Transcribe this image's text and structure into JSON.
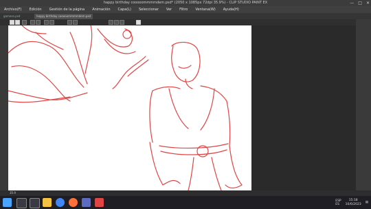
{
  "titlebar": {
    "title": "happy birthday cooooommmmdem.psd* (2050 x 1085px 72dpi 35.9%) - CLIP STUDIO PAINT EX",
    "min": "—",
    "max": "□",
    "close": "✕"
  },
  "menu": [
    "Archivo(F)",
    "Edición",
    "Gestión de la página",
    "Animación",
    "Capa(L)",
    "Seleccionar",
    "Ver",
    "Filtro",
    "Ventana(W)",
    "Ayuda(H)"
  ],
  "tabs": [
    "gamesa.psd",
    "happy birthday cooooommmmdem.psd"
  ],
  "status": {
    "zoom": "35.9"
  },
  "tray": {
    "lang": "ESP",
    "region": "ES",
    "time": "15:18",
    "date": "10/6/2023"
  },
  "colors": {
    "accent": "#e04545",
    "canvas": "#ffffff"
  },
  "taskbar_icons": [
    "windows-icon",
    "search-icon",
    "taskview-icon",
    "explorer-icon",
    "chrome-icon",
    "firefox-icon",
    "photos-icon",
    "clipstudio-icon"
  ]
}
